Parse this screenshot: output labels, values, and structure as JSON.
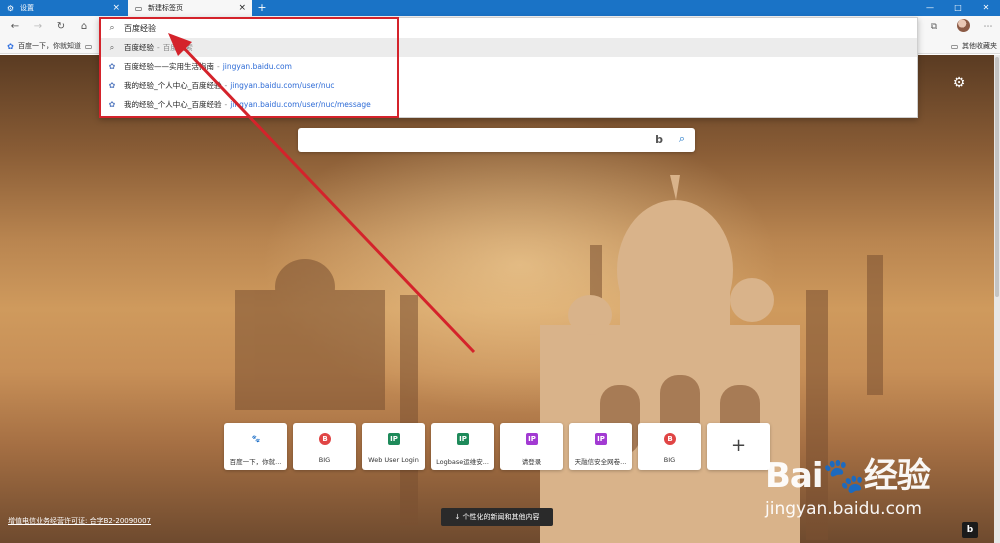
{
  "tabs": [
    {
      "label": "设置",
      "icon": "gear-icon"
    },
    {
      "label": "新建标签页",
      "icon": "newtab-icon"
    }
  ],
  "window_controls": {
    "minimize": "—",
    "maximize": "□",
    "close": "✕"
  },
  "address_bar": {
    "value": "百度经验"
  },
  "suggestions": [
    {
      "title": "百度经验",
      "sep": "-",
      "sub": "百度搜索",
      "url": ""
    },
    {
      "title": "百度经验——实用生活指南",
      "sep": "-",
      "sub": "",
      "url": "jingyan.baidu.com"
    },
    {
      "title": "我的经验_个人中心_百度经验",
      "sep": "-",
      "sub": "",
      "url": "jingyan.baidu.com/user/nuc"
    },
    {
      "title": "我的经验_个人中心_百度经验",
      "sep": "-",
      "sub": "",
      "url": "jingyan.baidu.com/user/nuc/message"
    }
  ],
  "bookmarks": {
    "first": "百度一下，你就知道",
    "other": "其他收藏夹"
  },
  "quick_links": [
    {
      "label": "百度一下，你就...",
      "icon_text": "🐾",
      "color": "#2f6fe0"
    },
    {
      "label": "BIG",
      "icon_text": "B",
      "color": "#e04545"
    },
    {
      "label": "Web User Login",
      "icon_text": "IP",
      "color": "#1e8a5a"
    },
    {
      "label": "Logbase运维安...",
      "icon_text": "IP",
      "color": "#1e8a5a"
    },
    {
      "label": "请登录",
      "icon_text": "IP",
      "color": "#a23ad2"
    },
    {
      "label": "天融信安全网卷...",
      "icon_text": "IP",
      "color": "#a23ad2"
    },
    {
      "label": "BIG",
      "icon_text": "B",
      "color": "#e04545"
    }
  ],
  "add_tile": "+",
  "license": "增值电信业务经营许可证: 合字B2-20090007",
  "news_button": "↓ 个性化的新闻和其他内容",
  "watermark": {
    "title": "Bai🐾经验",
    "url": "jingyan.baidu.com"
  },
  "colors": {
    "accent": "#1a73c6",
    "highlight_frame": "#d4232b"
  }
}
